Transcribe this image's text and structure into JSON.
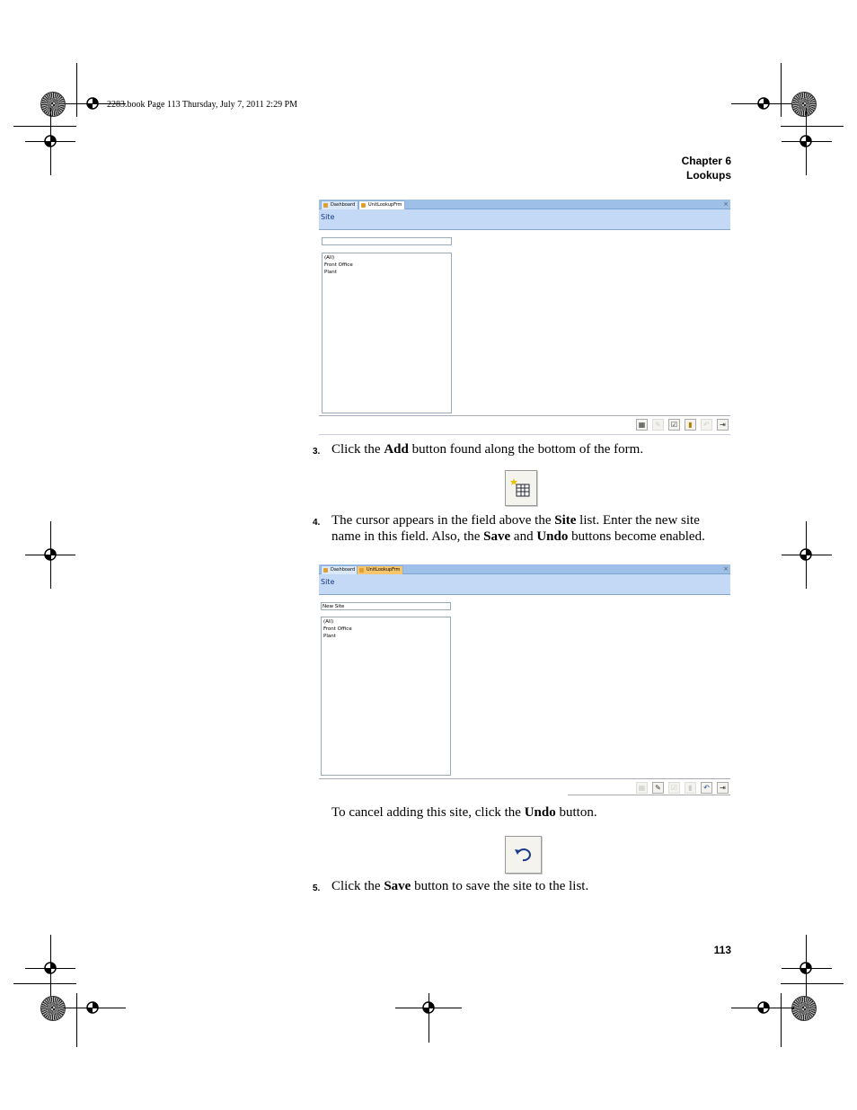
{
  "header": {
    "slug": "2283.book  Page 113  Thursday, July 7, 2011  2:29 PM",
    "chapter": "Chapter 6",
    "section": "Lookups"
  },
  "screenshot1": {
    "tabs": [
      "Dashboard",
      "UnitLookupFrm"
    ],
    "form_title": "Site",
    "field_value": "",
    "list_items": [
      "(All)",
      "Front Office",
      "Plant"
    ],
    "toolbar_icons": [
      "add-icon",
      "save-icon",
      "edit-icon",
      "delete-icon",
      "undo-icon",
      "exit-icon"
    ]
  },
  "step3": {
    "number": "3.",
    "text_before": "Click the ",
    "bold": "Add",
    "text_after": " button found along the bottom of the form."
  },
  "step4": {
    "number": "4.",
    "line1_before": "The cursor appears in the field above the ",
    "line1_bold": "Site",
    "line1_after": " list. Enter the new site",
    "line2_before": "name in this field. Also, the ",
    "line2_bold1": "Save",
    "line2_mid": " and ",
    "line2_bold2": "Undo",
    "line2_after": " buttons become enabled."
  },
  "screenshot2": {
    "tabs": [
      "Dashboard",
      "UnitLookupFrm"
    ],
    "form_title": "Site",
    "field_value": "New Site",
    "list_items": [
      "(All)",
      "Front Office",
      "Plant"
    ]
  },
  "cancel_note": {
    "before": "To cancel adding this site, click the ",
    "bold": "Undo",
    "after": " button."
  },
  "step5": {
    "number": "5.",
    "text_before": "Click the ",
    "bold": "Save",
    "text_after": " button to save the site to the list."
  },
  "footer": {
    "page_number": "113"
  }
}
